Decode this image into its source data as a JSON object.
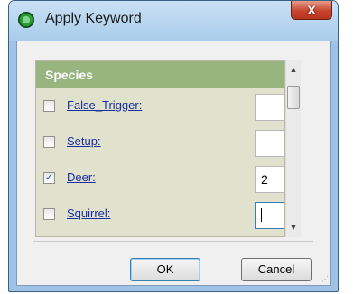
{
  "window": {
    "title": "Apply Keyword",
    "close_glyph": "X"
  },
  "panel": {
    "header": "Species",
    "rows": [
      {
        "label": "False_Trigger:",
        "checked": false,
        "value": ""
      },
      {
        "label": "Setup:",
        "checked": false,
        "value": ""
      },
      {
        "label": "Deer:",
        "checked": true,
        "value": "2"
      },
      {
        "label": "Squirrel:",
        "checked": false,
        "value": ""
      }
    ]
  },
  "buttons": {
    "ok": "OK",
    "cancel": "Cancel"
  },
  "icons": {
    "app": "green-circle-icon",
    "check": "checkmark-icon"
  }
}
